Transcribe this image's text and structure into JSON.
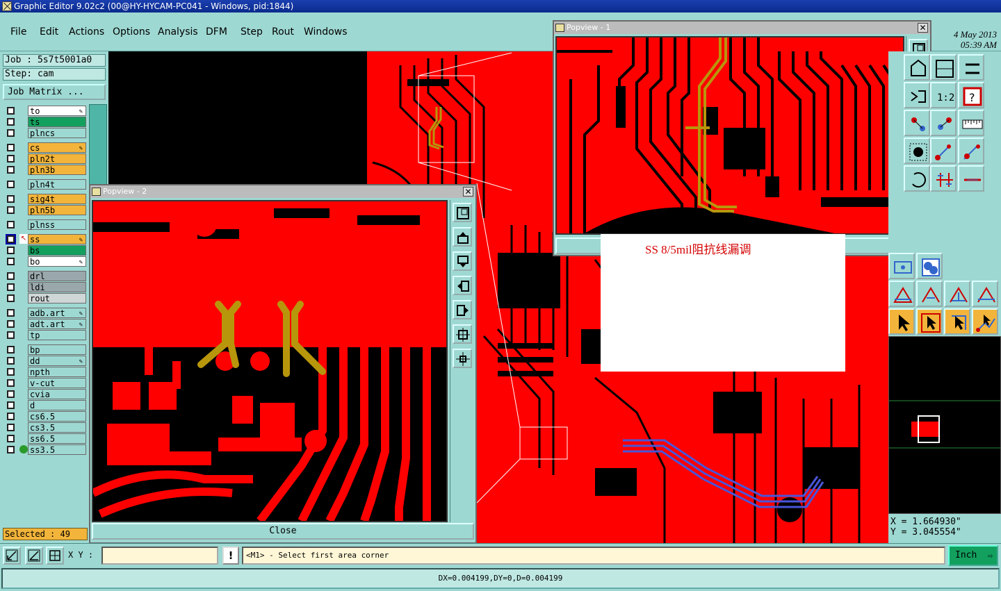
{
  "window": {
    "title": "Graphic Editor 9.02c2 (00@HY-HYCAM-PC041 - Windows, pid:1844)"
  },
  "menu": [
    "File",
    "Edit",
    "Actions",
    "Options",
    "Analysis",
    "DFM",
    "Step",
    "Rout",
    "Windows"
  ],
  "datetime": {
    "date": "4 May 2013",
    "time": "05:39 AM"
  },
  "left_panel": {
    "job_label": "Job : 5s7t5001a0",
    "step_label": "Step: cam",
    "job_matrix_button": "Job Matrix ..."
  },
  "layers": [
    {
      "name": "to",
      "color": "white",
      "pen": true
    },
    {
      "name": "ts",
      "color": "green",
      "pen": false
    },
    {
      "name": "plncs",
      "color": "cyan",
      "pen": false
    },
    {
      "name": "cs",
      "color": "orange",
      "pen": true
    },
    {
      "name": "pln2t",
      "color": "orange",
      "pen": false
    },
    {
      "name": "pln3b",
      "color": "orange",
      "pen": false
    },
    {
      "name": "pln4t",
      "color": "cyan",
      "pen": false
    },
    {
      "name": "sig4t",
      "color": "orange",
      "pen": false
    },
    {
      "name": "pln5b",
      "color": "orange",
      "pen": false
    },
    {
      "name": "plnss",
      "color": "cyan",
      "pen": false
    },
    {
      "name": "ss",
      "color": "orange",
      "pen": true,
      "work": true
    },
    {
      "name": "bs",
      "color": "green",
      "pen": false
    },
    {
      "name": "bo",
      "color": "white",
      "pen": true
    },
    {
      "name": "drl",
      "color": "gray",
      "pen": false
    },
    {
      "name": "ldi",
      "color": "gray",
      "pen": false
    },
    {
      "name": "rout",
      "color": "lgray",
      "pen": false
    },
    {
      "name": "adb.art",
      "color": "cyan",
      "pen": true
    },
    {
      "name": "adt.art",
      "color": "cyan",
      "pen": true
    },
    {
      "name": "tp",
      "color": "cyan",
      "pen": false
    },
    {
      "name": "bp",
      "color": "cyan",
      "pen": false
    },
    {
      "name": "dd",
      "color": "cyan",
      "pen": true
    },
    {
      "name": "npth",
      "color": "cyan",
      "pen": false
    },
    {
      "name": "v-cut",
      "color": "cyan",
      "pen": false
    },
    {
      "name": "cvia",
      "color": "cyan",
      "pen": false
    },
    {
      "name": "d",
      "color": "cyan",
      "pen": false
    },
    {
      "name": "cs6.5",
      "color": "cyan",
      "pen": false
    },
    {
      "name": "cs3.5",
      "color": "cyan",
      "pen": false
    },
    {
      "name": "ss6.5",
      "color": "cyan",
      "pen": false
    },
    {
      "name": "ss3.5",
      "color": "cyan",
      "pen": false,
      "ok": true
    }
  ],
  "selected_label": "Selected : 49",
  "popview1": {
    "title": "Popview - 1"
  },
  "popview2": {
    "title": "Popview - 2",
    "close_label": "Close"
  },
  "annotation": "SS 8/5mil阻抗线漏调",
  "coords": {
    "x": "X = 1.664930\"",
    "y": "Y = 3.045554\""
  },
  "command": {
    "xy_label": "X Y :",
    "xy_value": "",
    "bang": "!",
    "prompt": "<M1> - Select first area corner",
    "unit_button": "Inch"
  },
  "status": "DX=0.004199,DY=0,D=0.004199",
  "colors": {
    "board": "#ff0000",
    "trace_gold": "#b8960c",
    "trace_blue": "#4a55d8",
    "panel": "#9ed8d2",
    "layer_orange": "#f2b43a",
    "layer_green": "#13a05f"
  },
  "icons": {
    "right_toolbar": [
      "zoom-home-icon",
      "fit-icon",
      "measure-icon",
      "snap-icon",
      "ratio-icon",
      "help-icon",
      "net-icon",
      "net-alt-icon",
      "ruler-icon",
      "dot-icon",
      "drag-icon",
      "connect-icon",
      "rotate-icon",
      "flip-icon",
      "line-icon",
      "center-icon",
      "pad-icon",
      "shape-a-icon",
      "shape-b-icon",
      "shape-c-icon",
      "shape-d-icon",
      "select-icon",
      "select-box-icon",
      "select-net-icon",
      "select-route-icon"
    ]
  }
}
